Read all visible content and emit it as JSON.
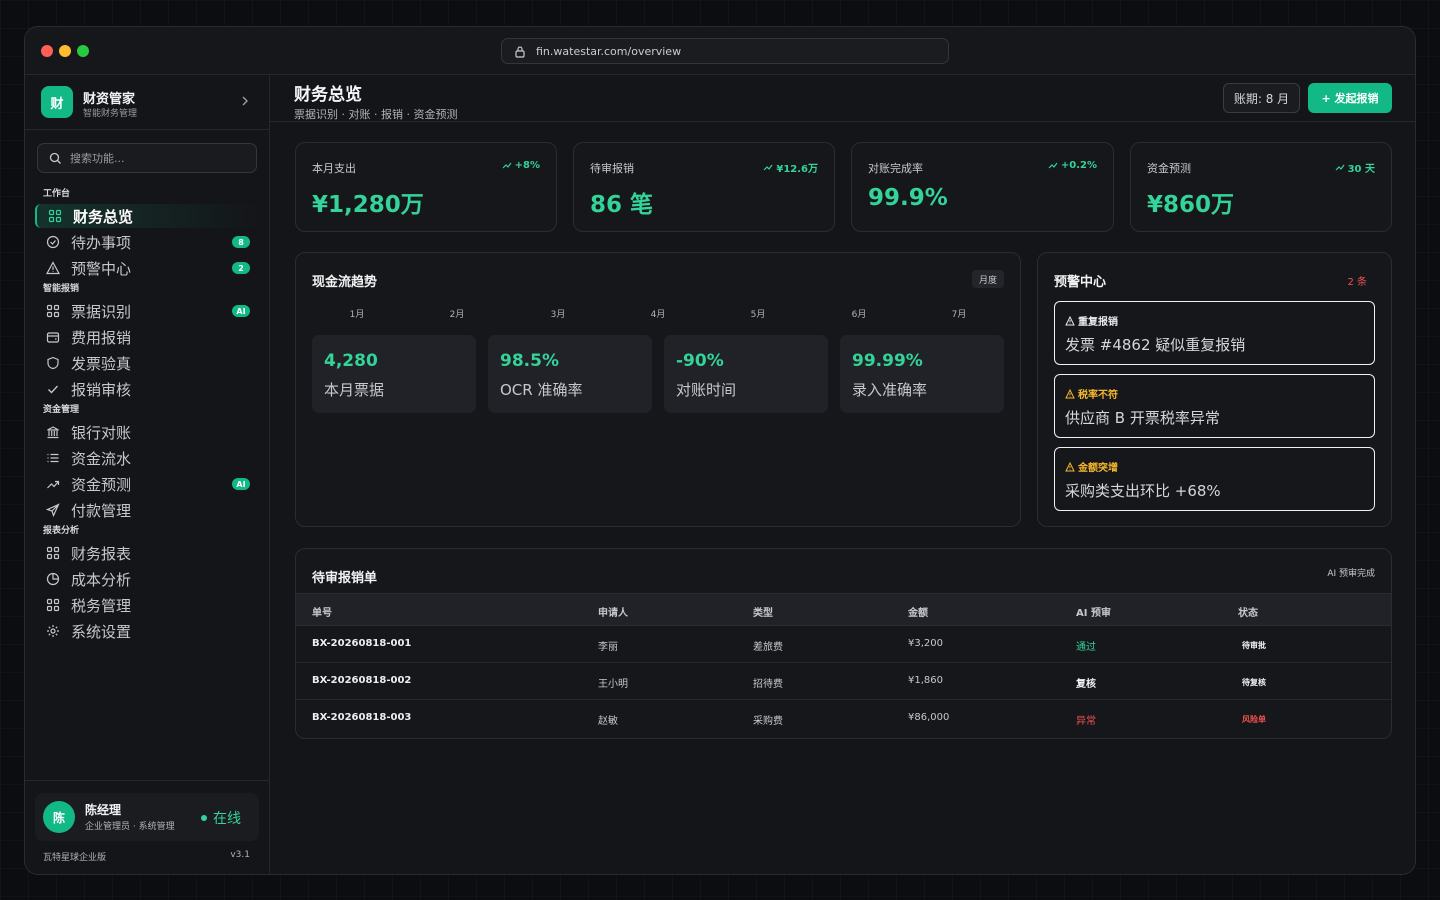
{
  "browser": {
    "url": "fin.watestar.com/overview"
  },
  "brand": {
    "logo": "财",
    "name": "财资管家",
    "subtitle": "智能财务管理"
  },
  "search": {
    "placeholder": "搜索功能..."
  },
  "sections": {
    "workbench": "工作台",
    "smart_expense": "智能报销",
    "funds": "资金管理",
    "reports": "报表分析"
  },
  "nav": {
    "overview": "财务总览",
    "todo": "待办事项",
    "todo_badge": "8",
    "alerts": "预警中心",
    "alerts_badge": "2",
    "ocr": "票据识别",
    "ocr_badge": "AI",
    "expense": "费用报销",
    "invoice": "发票验真",
    "audit": "报销审核",
    "bank": "银行对账",
    "flow": "资金流水",
    "forecast": "资金预测",
    "forecast_badge": "AI",
    "payment": "付款管理",
    "statements": "财务报表",
    "cost": "成本分析",
    "tax": "税务管理",
    "settings": "系统设置"
  },
  "user": {
    "avatar": "陈",
    "name": "陈经理",
    "role": "企业管理员 · 系统管理",
    "status": "在线",
    "org": "瓦特星球企业版",
    "version": "v3.1"
  },
  "header": {
    "title": "财务总览",
    "subtitle": "票据识别 · 对账 · 报销 · 资金预测",
    "period": "账期: 8 月",
    "primary_action": "+ 发起报销"
  },
  "kpis": [
    {
      "label": "本月支出",
      "delta": "+8%",
      "value": "¥1,280万"
    },
    {
      "label": "待审报销",
      "delta": "¥12.6万",
      "value": "86 笔"
    },
    {
      "label": "对账完成率",
      "delta": "+0.2%",
      "value": "99.9%"
    },
    {
      "label": "资金预测",
      "delta": "30 天",
      "value": "¥860万"
    }
  ],
  "cashflow": {
    "title": "现金流趋势",
    "chip": "月度",
    "months": [
      "1月",
      "2月",
      "3月",
      "4月",
      "5月",
      "6月",
      "7月"
    ],
    "stats": [
      {
        "value": "4,280",
        "label": "本月票据"
      },
      {
        "value": "98.5%",
        "label": "OCR 准确率"
      },
      {
        "value": "-90%",
        "label": "对账时间"
      },
      {
        "value": "99.99%",
        "label": "录入准确率"
      }
    ]
  },
  "alerts_panel": {
    "title": "预警中心",
    "count": "2 条",
    "items": [
      {
        "tag": "重复报销",
        "text": "发票 #4862 疑似重复报销",
        "color": "#e8e9ec"
      },
      {
        "tag": "税率不符",
        "text": "供应商 B 开票税率异常",
        "color": "#f5b82e"
      },
      {
        "tag": "金额突增",
        "text": "采购类支出环比 +68%",
        "color": "#f5b82e"
      }
    ]
  },
  "pending": {
    "title": "待审报销单",
    "note": "AI 预审完成",
    "columns": [
      "单号",
      "申请人",
      "类型",
      "金额",
      "AI 预审",
      "状态"
    ],
    "rows": [
      {
        "id": "BX-20260818-001",
        "applicant": "李丽",
        "type": "差旅费",
        "amount": "¥3,200",
        "ai": "通过",
        "ai_color": "#34d399",
        "status": "待审批",
        "status_color": "#f1f2f4"
      },
      {
        "id": "BX-20260818-002",
        "applicant": "王小明",
        "type": "招待费",
        "amount": "¥1,860",
        "ai": "复核",
        "ai_color": "#f1f2f4",
        "status": "待复核",
        "status_color": "#f1f2f4"
      },
      {
        "id": "BX-20260818-003",
        "applicant": "赵敏",
        "type": "采购费",
        "amount": "¥86,000",
        "ai": "异常",
        "ai_color": "#f05252",
        "status": "风险单",
        "status_color": "#f05252"
      }
    ]
  },
  "colors": {
    "accent": "#12b886",
    "accent_text": "#34d399",
    "danger": "#f05252",
    "warning": "#f5b82e"
  }
}
